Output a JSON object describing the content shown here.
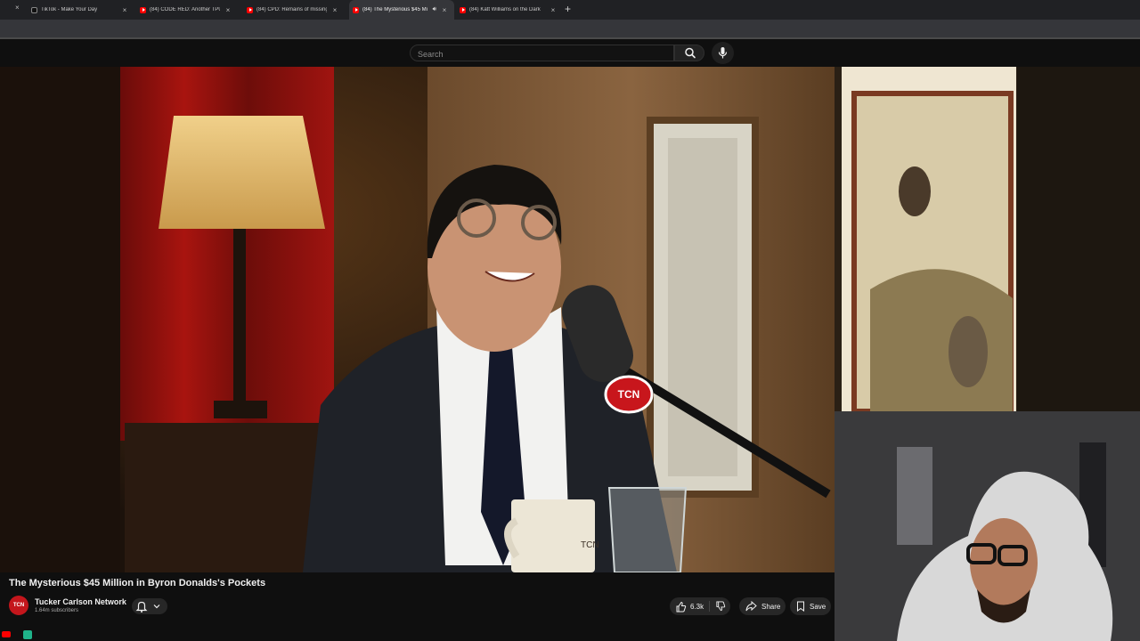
{
  "browser": {
    "tabs": [
      {
        "title": "TikTok - Make Your Day",
        "favicon": "tiktok-icon",
        "active": false
      },
      {
        "title": "(84) CODE RED: Another TPUSA",
        "favicon": "youtube-icon",
        "active": false
      },
      {
        "title": "(84) CPD: Remains of missing C",
        "favicon": "youtube-icon",
        "active": false
      },
      {
        "title": "(84) The Mysterious $45 Mi",
        "favicon": "youtube-icon",
        "active": true
      },
      {
        "title": "(84) Katt Williams on the Dark",
        "favicon": "youtube-icon",
        "active": false
      }
    ],
    "close_glyph": "×",
    "new_tab_glyph": "+"
  },
  "header": {
    "search_placeholder": "Search",
    "search_icon": "search-icon",
    "mic_icon": "microphone-icon"
  },
  "video": {
    "title": "The Mysterious $45 Million in Byron Donalds's Pockets",
    "mic_logo": "TCN",
    "mug_text": "TCN"
  },
  "channel": {
    "avatar_text": "TCN",
    "name": "Tucker Carlson Network",
    "subscribers": "1.64m subscribers"
  },
  "actions": {
    "likes": "6.3k",
    "share_label": "Share",
    "save_label": "Save"
  },
  "colors": {
    "youtube_red": "#ff0000",
    "page_bg": "#0f0f0f",
    "pill_bg": "#272727",
    "tab_active_bg": "#35363a"
  }
}
